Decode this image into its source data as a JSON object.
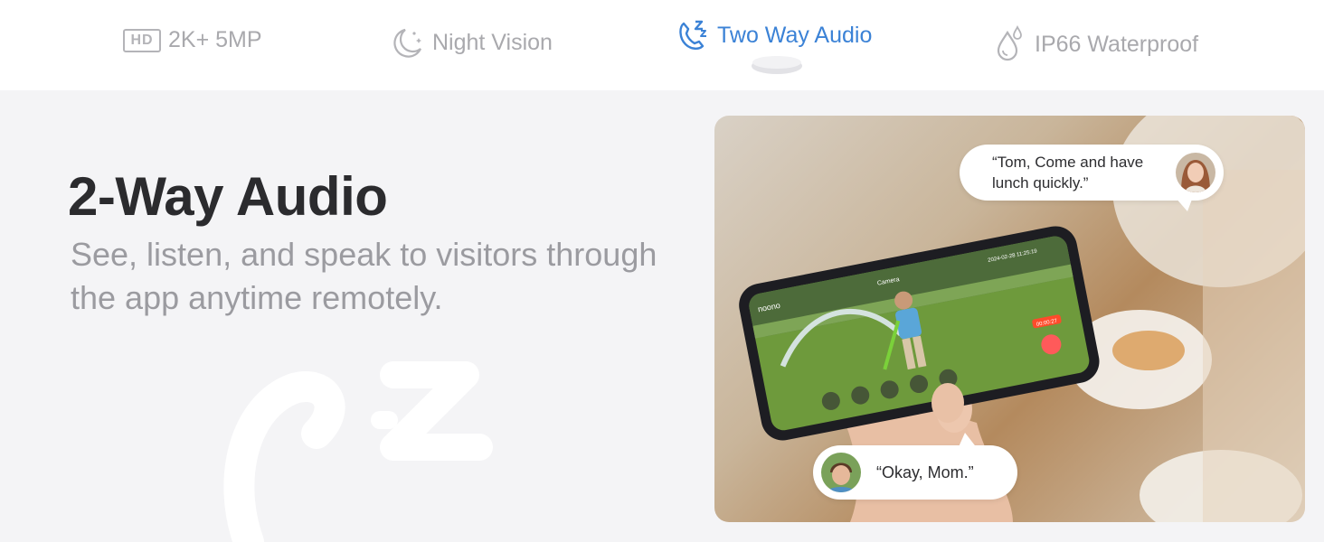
{
  "tabs": [
    {
      "label": "2K+ 5MP",
      "icon": "hd-icon",
      "badge": "HD",
      "active": false
    },
    {
      "label": "Night Vision",
      "icon": "moon-icon",
      "active": false
    },
    {
      "label": "Two Way Audio",
      "icon": "phone-audio-icon",
      "active": true
    },
    {
      "label": "IP66 Waterproof",
      "icon": "water-drop-icon",
      "active": false
    }
  ],
  "colors": {
    "accent": "#3b82d6",
    "inactive": "#a9a9ad",
    "headline": "#2b2b2e",
    "background": "#f4f4f6"
  },
  "hero": {
    "title": "2-Way Audio",
    "subtitle": "See, listen, and speak to visitors through the app anytime remotely."
  },
  "speech": {
    "mom": "“Tom, Come and have lunch quickly.”",
    "kid": "“Okay, Mom.”"
  },
  "phone_screen": {
    "brand": "noono",
    "camera_label": "Camera",
    "timestamp": "2024-02-28 11:25:19",
    "call_timer": "00:00:27"
  }
}
